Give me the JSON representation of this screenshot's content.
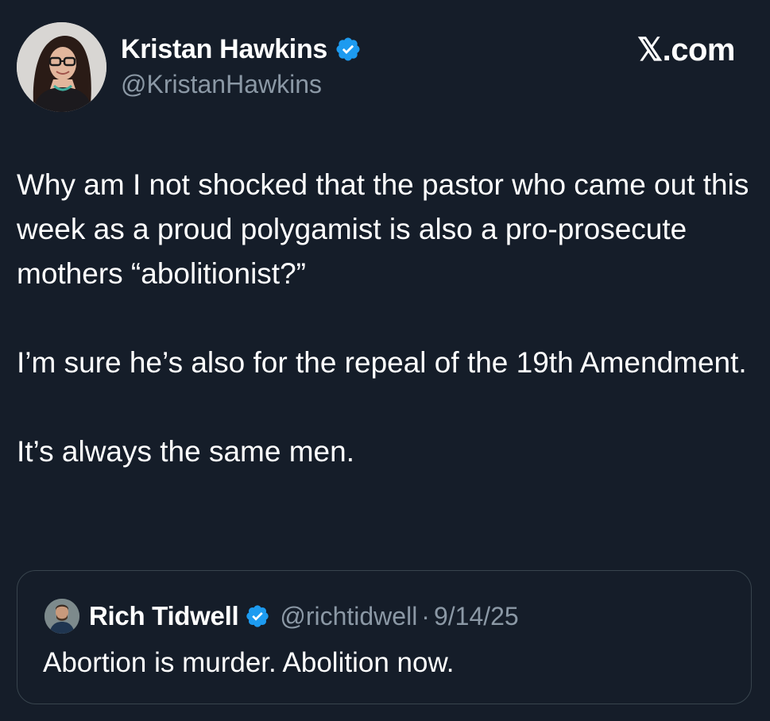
{
  "author": {
    "name": "Kristan Hawkins",
    "handle": "@KristanHawkins",
    "verified": true,
    "avatar_icon": "profile-photo"
  },
  "brand": "𝕏.com",
  "tweet": {
    "paragraphs": [
      "Why am I not shocked that the pastor who came out this week as a proud polygamist is also a pro-prosecute  mothers “abolitionist?”",
      "I’m sure he’s also for the repeal of the 19th Amendment.",
      "It’s always the same men."
    ]
  },
  "quote": {
    "name": "Rich Tidwell",
    "handle": "@richtidwell",
    "separator": "·",
    "date": "9/14/25",
    "text": "Abortion is murder. Abolition now.",
    "verified": true
  },
  "colors": {
    "background": "#151d29",
    "verified_blue": "#1d9bf0",
    "secondary_text": "#8b98a5",
    "border": "#38444d"
  }
}
